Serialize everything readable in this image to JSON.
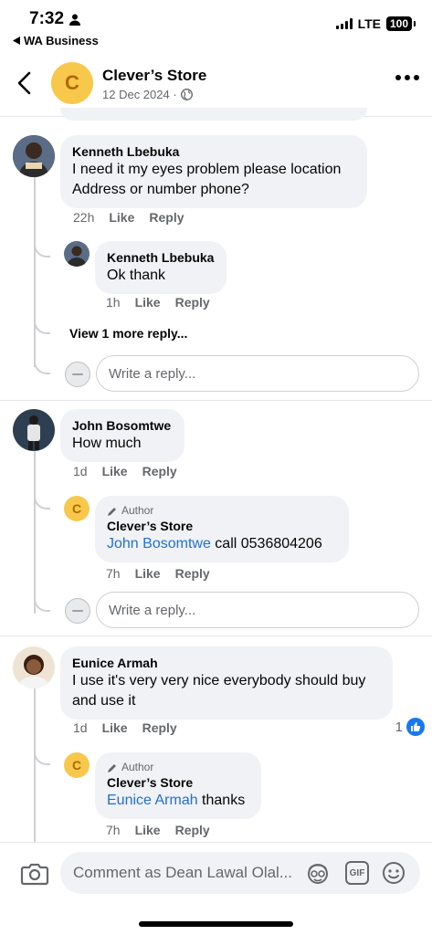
{
  "status_bar": {
    "time": "7:32",
    "back_app": "WA Business",
    "network": "LTE",
    "battery": "100"
  },
  "header": {
    "page_initial": "C",
    "page_name": "Clever’s Store",
    "post_date": "12 Dec 2024 · "
  },
  "comments": [
    {
      "author": "Kenneth Lbebuka",
      "text": "I need it my eyes problem  please location Address or number phone?",
      "time": "22h",
      "like_label": "Like",
      "reply_label": "Reply",
      "replies": [
        {
          "author": "Kenneth Lbebuka",
          "text": "Ok  thank",
          "time": "1h",
          "like_label": "Like",
          "reply_label": "Reply"
        }
      ],
      "view_more": "View 1 more reply..."
    },
    {
      "author": "John Bosomtwe",
      "text": "How much",
      "time": "1d",
      "like_label": "Like",
      "reply_label": "Reply",
      "replies": [
        {
          "badge": "Author",
          "author": "Clever’s Store",
          "initial": "C",
          "mention": "John Bosomtwe",
          "text": " call 0536804206",
          "time": "7h",
          "like_label": "Like",
          "reply_label": "Reply"
        }
      ]
    },
    {
      "author": "Eunice Armah",
      "text": "I use it's very very nice everybody should buy and use it",
      "time": "1d",
      "like_label": "Like",
      "reply_label": "Reply",
      "like_count": "1",
      "replies": [
        {
          "badge": "Author",
          "author": "Clever’s Store",
          "initial": "C",
          "mention": "Eunice Armah",
          "text": " thanks",
          "time": "7h",
          "like_label": "Like",
          "reply_label": "Reply"
        }
      ]
    }
  ],
  "reply_placeholder": "Write a reply...",
  "composer": {
    "placeholder": "Comment as Dean Lawal Olal...",
    "gif_label": "GIF"
  },
  "colors": {
    "accent": "#1877f2",
    "mention": "#216fdb",
    "bubble": "#f0f2f5",
    "store_avatar": "#f7c84b"
  }
}
